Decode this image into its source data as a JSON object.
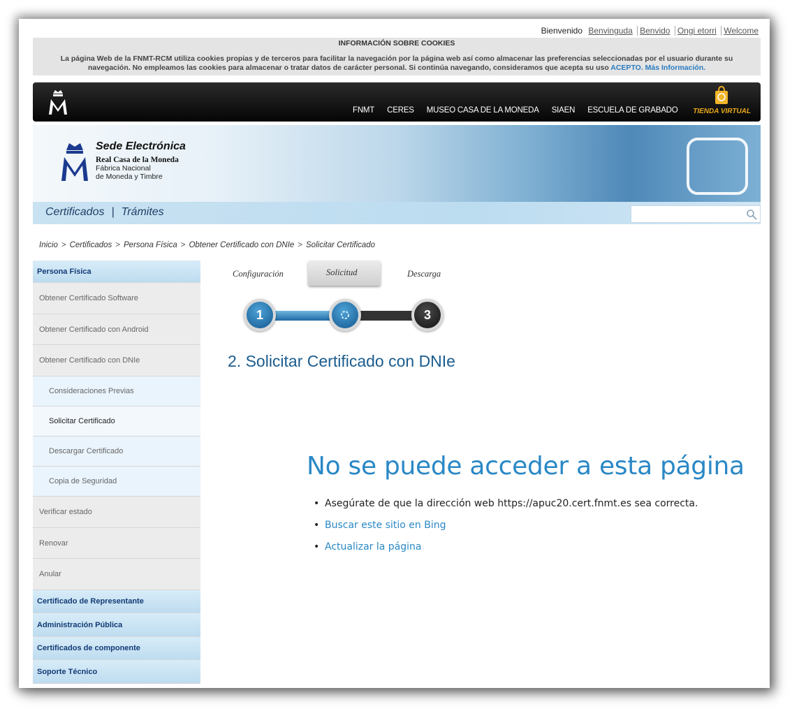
{
  "languages": {
    "current": "Bienvenido",
    "others": [
      "Benvinguda",
      "Benvido",
      "Ongi etorri",
      "Welcome"
    ]
  },
  "cookies": {
    "title": "INFORMACIÓN SOBRE COOKIES",
    "body": "La página Web de la FNMT-RCM utiliza cookies propias y de terceros para facilitar la navegación por la página web así como almacenar las preferencias seleccionadas por el usuario durante su navegación. No empleamos las cookies para almacenar o tratar datos de carácter personal. Si continúa navegando, consideramos que acepta su uso",
    "accept": "ACEPTO.",
    "more": "Más Información."
  },
  "topnav": {
    "items": [
      "FNMT",
      "CERES",
      "MUSEO CASA DE LA MONEDA",
      "SIAEN",
      "ESCUELA DE GRABADO"
    ],
    "store": "TIENDA VIRTUAL"
  },
  "banner": {
    "title": "Sede Electrónica",
    "org": "Real Casa de la Moneda",
    "line1": "Fábrica Nacional",
    "line2": "de Moneda y Timbre"
  },
  "subnav": {
    "certificados": "Certificados",
    "separator": "|",
    "tramites": "Trámites"
  },
  "breadcrumb": [
    "Inicio",
    "Certificados",
    "Persona Física",
    "Obtener Certificado con DNIe",
    "Solicitar Certificado"
  ],
  "sidebar": {
    "items": [
      {
        "label": "Persona Física",
        "kind": "blue"
      },
      {
        "label": "Obtener Certificado Software",
        "kind": "grey"
      },
      {
        "label": "Obtener Certificado con Android",
        "kind": "grey"
      },
      {
        "label": "Obtener Certificado con DNIe",
        "kind": "grey"
      },
      {
        "label": "Consideraciones Previas",
        "kind": "sub"
      },
      {
        "label": "Solicitar Certificado",
        "kind": "sub-active"
      },
      {
        "label": "Descargar Certificado",
        "kind": "sub"
      },
      {
        "label": "Copia de Seguridad",
        "kind": "sub"
      },
      {
        "label": "Verificar estado",
        "kind": "grey"
      },
      {
        "label": "Renovar",
        "kind": "grey"
      },
      {
        "label": "Anular",
        "kind": "grey"
      },
      {
        "label": "Certificado de Representante",
        "kind": "blue"
      },
      {
        "label": "Administración Pública",
        "kind": "blue"
      },
      {
        "label": "Certificados de componente",
        "kind": "blue"
      },
      {
        "label": "Soporte Técnico",
        "kind": "blue"
      }
    ]
  },
  "steps": {
    "labels": [
      "Configuración",
      "Solicitud",
      "Descarga"
    ],
    "numbers": [
      "1",
      "",
      "3"
    ],
    "current": 2
  },
  "page_title": "2. Solicitar Certificado con DNIe",
  "error": {
    "title": "No se puede acceder a esta página",
    "items": [
      "Asegúrate de que la dirección web https://apuc20.cert.fnmt.es sea correcta.",
      "Buscar este sitio en Bing",
      "Actualizar la página"
    ]
  }
}
